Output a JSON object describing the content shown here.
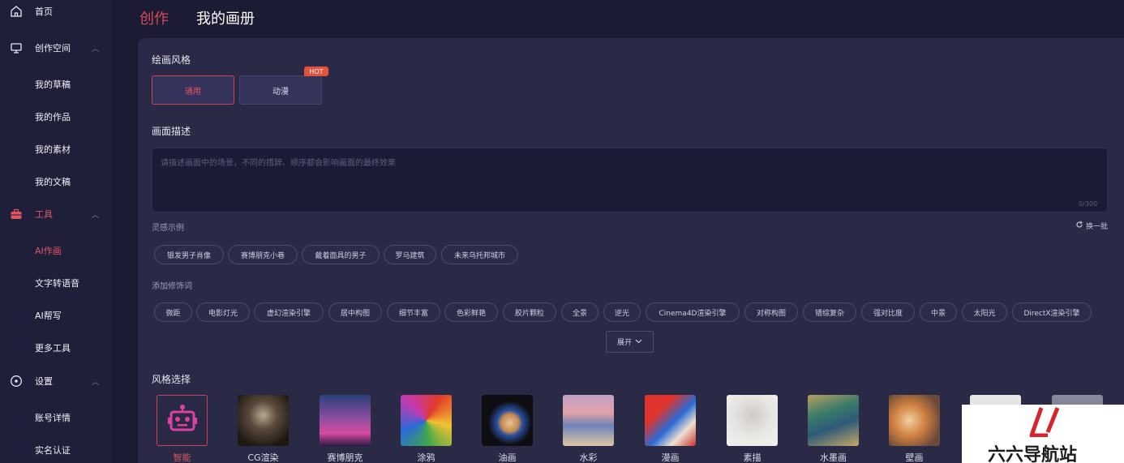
{
  "sidebar": {
    "home": "首页",
    "create_space": "创作空间",
    "create_items": [
      "我的草稿",
      "我的作品",
      "我的素材",
      "我的文稿"
    ],
    "tools": "工具",
    "tool_items": [
      "AI作画",
      "文字转语音",
      "AI帮写",
      "更多工具"
    ],
    "settings": "设置",
    "settings_items": [
      "账号详情",
      "实名认证"
    ]
  },
  "header": {
    "tab_create": "创作",
    "tab_album": "我的画册"
  },
  "paint_style": {
    "title": "绘画风格",
    "options": [
      "通用",
      "动漫"
    ],
    "selected": "通用",
    "hot_badge": "HOT"
  },
  "description": {
    "title": "画面描述",
    "placeholder": "请描述画面中的场景，不同的措辞、顺序都会影响画面的最终效果",
    "value": "",
    "counter": "0/300"
  },
  "inspiration": {
    "title": "灵感示例",
    "refresh_label": "换一批",
    "examples": [
      "银发男子肖像",
      "赛博朋克小巷",
      "戴着面具的男子",
      "罗马建筑",
      "未来乌托邦城市"
    ]
  },
  "modifiers": {
    "title": "添加修饰词",
    "items": [
      "微距",
      "电影灯光",
      "虚幻渲染引擎",
      "居中构图",
      "细节丰富",
      "色彩鲜艳",
      "胶片颗粒",
      "全景",
      "逆光",
      "Cinema4D渲染引擎",
      "对称构图",
      "错综复杂",
      "强对比度",
      "中景",
      "太阳光",
      "DirectX渲染引擎"
    ],
    "expand_label": "展开"
  },
  "style_select": {
    "title": "风格选择",
    "styles": [
      "智能",
      "CG渲染",
      "赛博朋克",
      "涂鸦",
      "油画",
      "水彩",
      "漫画",
      "素描",
      "水墨画",
      "壁画"
    ],
    "selected": "智能"
  },
  "watermark": {
    "text": "六六导航站"
  },
  "colors": {
    "accent": "#e05560",
    "background": "#1c1b34",
    "panel": "#2a2946",
    "sidebar": "#201f3a"
  }
}
